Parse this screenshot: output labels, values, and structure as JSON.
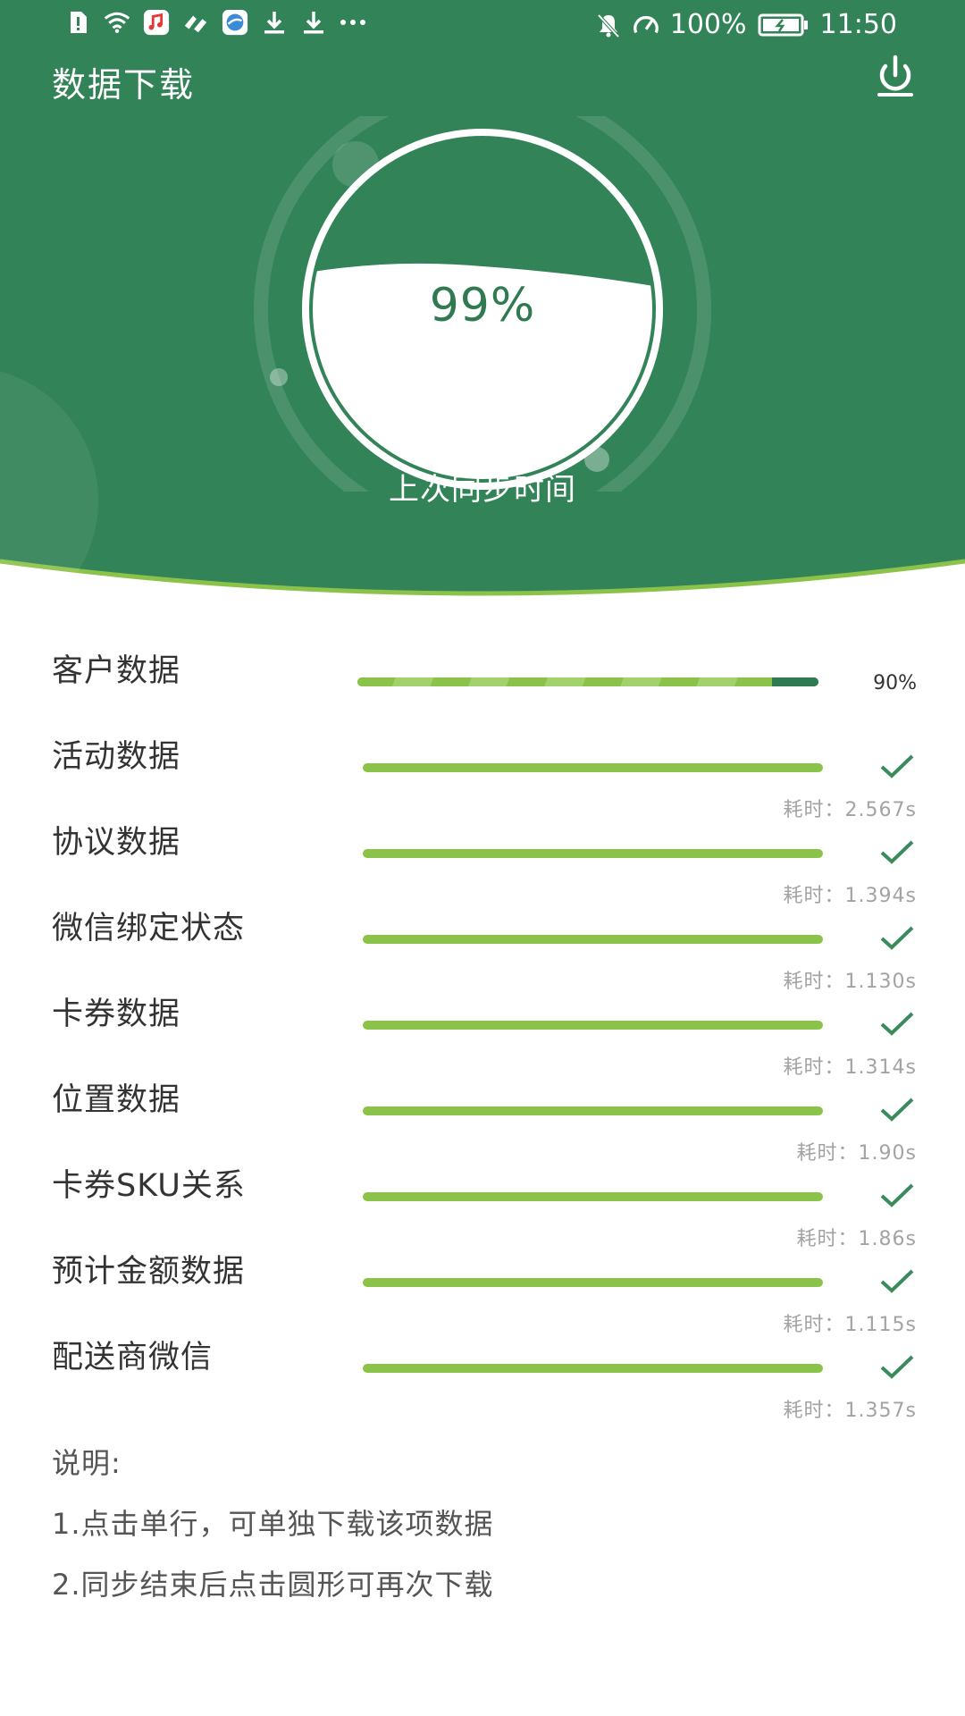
{
  "status_bar": {
    "battery": "100%",
    "time": "11:50",
    "left_icons": [
      "sim-alert-icon",
      "wifi-icon",
      "music-app-icon",
      "signal-app-icon",
      "browser-app-icon",
      "download-icon",
      "download-icon",
      "more-dots-icon"
    ],
    "right_icons": [
      "mute-icon",
      "speed-icon",
      "battery-icon"
    ]
  },
  "header": {
    "title": "数据下载",
    "power_icon": "power-icon"
  },
  "sync": {
    "progress_text": "99%",
    "progress": 0.99,
    "caption": "上次同步时间"
  },
  "colors": {
    "header_green": "#338358",
    "bar_green": "#8bc34a",
    "dark_green": "#2f7a50",
    "check_green": "#3b8a5e"
  },
  "items": [
    {
      "label": "客户数据",
      "status": "loading",
      "progress": 0.9,
      "percent": "90%"
    },
    {
      "label": "活动数据",
      "status": "done",
      "progress": 1,
      "elapsed": "耗时：2.567s"
    },
    {
      "label": "协议数据",
      "status": "done",
      "progress": 1,
      "elapsed": "耗时：1.394s"
    },
    {
      "label": "微信绑定状态",
      "status": "done",
      "progress": 1,
      "elapsed": "耗时：1.130s"
    },
    {
      "label": "卡券数据",
      "status": "done",
      "progress": 1,
      "elapsed": "耗时：1.314s"
    },
    {
      "label": "位置数据",
      "status": "done",
      "progress": 1,
      "elapsed": "耗时：1.90s"
    },
    {
      "label": "卡券SKU关系",
      "status": "done",
      "progress": 1,
      "elapsed": "耗时：1.86s"
    },
    {
      "label": "预计金额数据",
      "status": "done",
      "progress": 1,
      "elapsed": "耗时：1.115s"
    },
    {
      "label": "配送商微信",
      "status": "done",
      "progress": 1,
      "elapsed": "耗时：1.357s"
    }
  ],
  "notes": {
    "title": "说明:",
    "lines": [
      "1.点击单行，可单独下载该项数据",
      "2.同步结束后点击圆形可再次下载"
    ]
  }
}
